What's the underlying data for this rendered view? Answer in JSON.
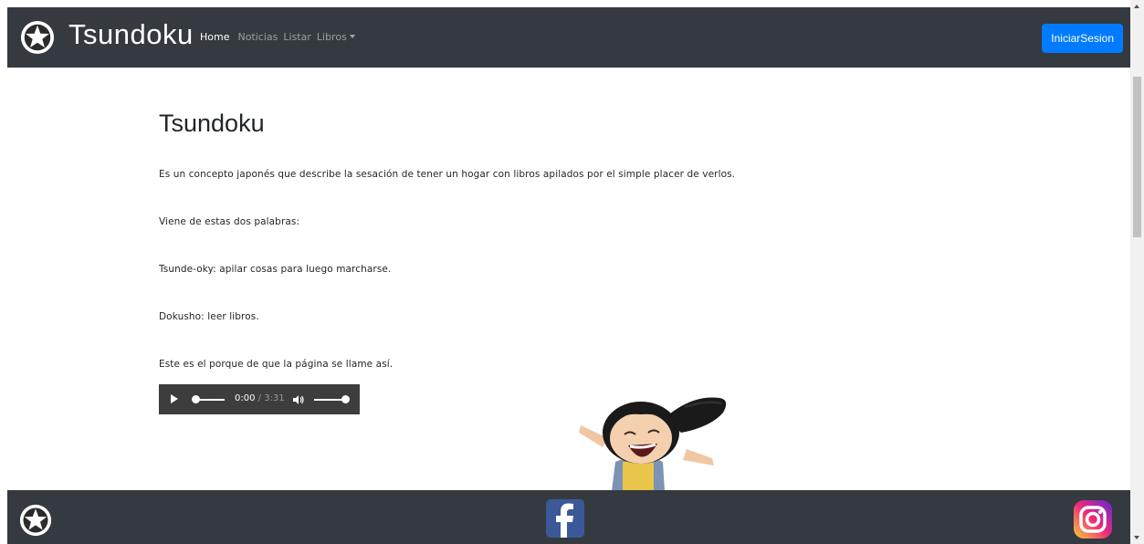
{
  "navbar": {
    "brand": "Tsundoku",
    "links": [
      {
        "label": "Home"
      },
      {
        "label": "Noticias"
      },
      {
        "label": "Listar"
      },
      {
        "label": "Libros"
      }
    ],
    "login_label": "IniciarSesion"
  },
  "main": {
    "title": "Tsundoku",
    "paragraphs": [
      "Es un concepto japonés que describe la sesación de tener un hogar con libros apilados por el simple placer de verlos.",
      "Viene de estas dos palabras:",
      "Tsunde-oky: apilar cosas para luego marcharse.",
      "Dokusho: leer libros.",
      "Este es el porque de que la página se llame así."
    ]
  },
  "audio": {
    "current_time": "0:00",
    "separator": " / ",
    "duration": "3:31",
    "progress": 0,
    "volume": 1
  },
  "footer": {
    "icons": [
      "star-logo-icon",
      "facebook-icon",
      "instagram-icon"
    ]
  },
  "colors": {
    "navbar_bg": "#343a40",
    "accent": "#007bff",
    "facebook": "#3b5998"
  }
}
